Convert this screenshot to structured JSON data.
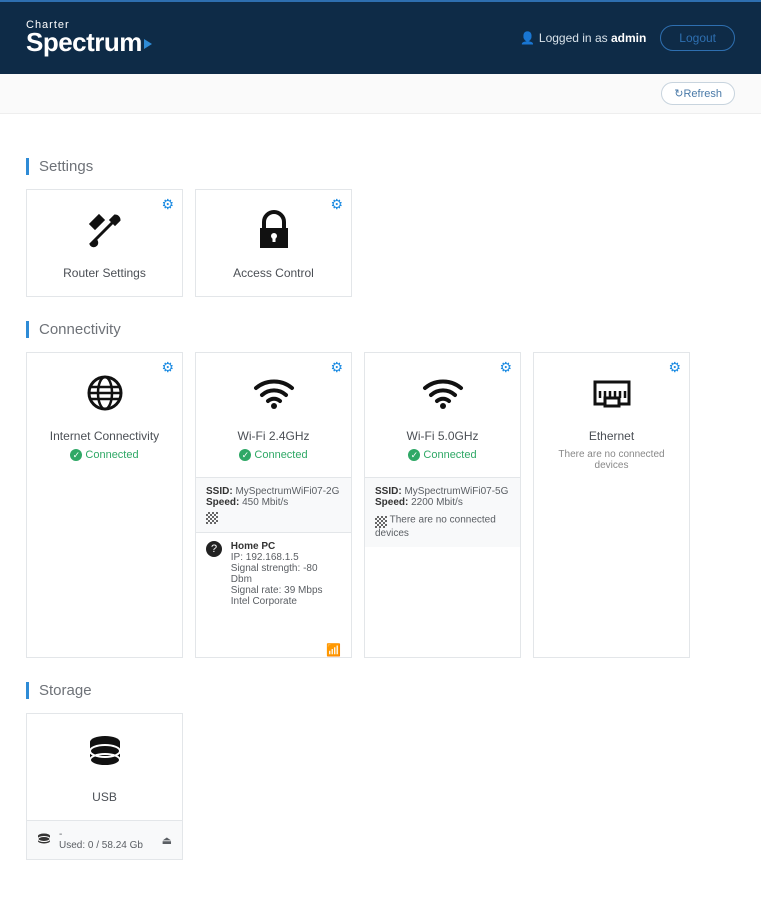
{
  "header": {
    "brand_small": "Charter",
    "brand_big": "Spectrum",
    "logged_prefix": "Logged in as ",
    "logged_user": "admin",
    "logout_label": "Logout"
  },
  "subbar": {
    "refresh_label": "Refresh"
  },
  "sections": {
    "settings": {
      "title": "Settings"
    },
    "connectivity": {
      "title": "Connectivity"
    },
    "storage": {
      "title": "Storage"
    }
  },
  "cards": {
    "router": {
      "title": "Router Settings"
    },
    "access": {
      "title": "Access Control"
    },
    "internet": {
      "title": "Internet Connectivity",
      "status": "Connected"
    },
    "wifi24": {
      "title": "Wi-Fi 2.4GHz",
      "status": "Connected",
      "ssid_label": "SSID:",
      "ssid": "MySpectrumWiFi07-2G",
      "speed_label": "Speed:",
      "speed": "450 Mbit/s",
      "device": {
        "name": "Home PC",
        "ip_label": "IP:",
        "ip": "192.168.1.5",
        "sig_strength_label": "Signal strength:",
        "sig_strength": "-80 Dbm",
        "sig_rate_label": "Signal rate:",
        "sig_rate": "39 Mbps",
        "vendor": "Intel Corporate"
      }
    },
    "wifi5": {
      "title": "Wi-Fi 5.0GHz",
      "status": "Connected",
      "ssid_label": "SSID:",
      "ssid": "MySpectrumWiFi07-5G",
      "speed_label": "Speed:",
      "speed": "2200 Mbit/s",
      "no_devices": "There are no connected devices"
    },
    "ethernet": {
      "title": "Ethernet",
      "no_devices": "There are no connected devices"
    },
    "usb": {
      "title": "USB",
      "name": "-",
      "used_label": "Used:",
      "used": "0 / 58.24 Gb"
    }
  }
}
